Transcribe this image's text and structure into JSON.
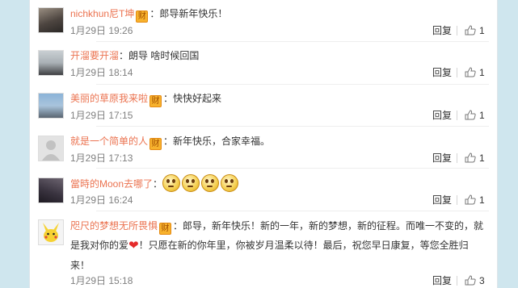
{
  "comments": [
    {
      "name": "nichkhun尼T坤",
      "vip": true,
      "vip_label": "财",
      "text": "：郎导新年快乐！",
      "time": "1月29日 19:26",
      "reply": "回复",
      "likes": "1"
    },
    {
      "name": "开溜要开溜",
      "vip": false,
      "text": "：朗导 啥时候回国",
      "time": "1月29日 18:14",
      "reply": "回复",
      "likes": "1"
    },
    {
      "name": "美丽的草原我来啦",
      "vip": true,
      "vip_label": "财",
      "text": "：快快好起来",
      "time": "1月29日 17:15",
      "reply": "回复",
      "likes": "1"
    },
    {
      "name": "就是一个简单的人",
      "vip": true,
      "vip_label": "财",
      "text": "：新年快乐，合家幸福。",
      "time": "1月29日 17:13",
      "reply": "回复",
      "likes": "1"
    },
    {
      "name": "當時的Moon去哪了",
      "vip": false,
      "text": "：",
      "emojis": 4,
      "time": "1月29日 16:24",
      "reply": "回复",
      "likes": "1"
    },
    {
      "name": "咫尺的梦想无所畏惧",
      "vip": true,
      "vip_label": "财",
      "text_a": "：郎导，新年快乐！新的一年，新的梦想，新的征程。而唯一不变的，就",
      "text_b": "是我对你的爱",
      "heart": "❤",
      "text_c": "！只愿在新的你年里，你被岁月温柔以待！最后，祝您早日康复，等您全胜归",
      "text_d": "来！",
      "time": "1月29日 15:18",
      "reply": "回复",
      "likes": "3"
    }
  ]
}
